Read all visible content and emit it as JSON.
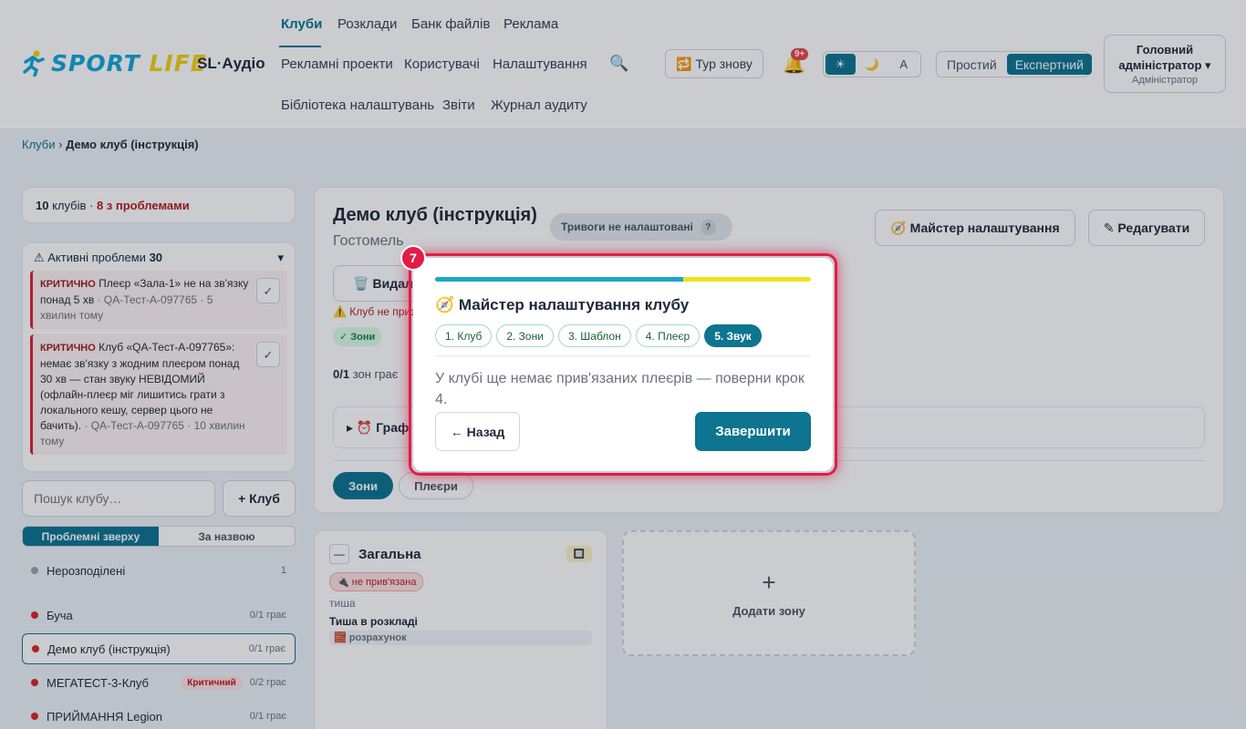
{
  "brand": {
    "logo_text_1": "SPORT ",
    "logo_text_2": "LIFE",
    "app_name": "SL·Аудіо",
    "accent": "#0e7490",
    "danger": "#dc2626"
  },
  "nav": {
    "row1": [
      "Клуби",
      "Розклади",
      "Банк файлів",
      "Реклама"
    ],
    "row2": [
      "Рекламні проекти",
      "Користувачі",
      "Налаштування"
    ],
    "row3": [
      "Бібліотека налаштувань",
      "Звіти",
      "Журнал аудиту"
    ],
    "active": "Клуби"
  },
  "header": {
    "search_icon": "🔍",
    "tour_label": "🔁 Тур знову",
    "bell_icon": "🔔",
    "bell_count": "9+",
    "theme_options": [
      "☀",
      "🌙",
      "A"
    ],
    "theme_active": "☀",
    "mode_simple": "Простий",
    "mode_expert": "Експертний",
    "user_name": "Головний адміністратор ▾",
    "user_role": "Адміністратор"
  },
  "breadcrumb": {
    "root": "Клуби",
    "separator": "›",
    "current": "Демо клуб (інструкція)"
  },
  "sidebar": {
    "summary_count": "10",
    "summary_clubs": " клубів · ",
    "summary_problems": "8 з проблемами",
    "issues_title": "⚠ Активні проблеми ",
    "issues_count": "30",
    "issues_toggle": "▾",
    "issues": [
      {
        "severity": "КРИТИЧНО",
        "text": " Плеєр «Зала-1» не на зв'язку понад 5 хв",
        "meta": " · QA-Тест-А-097765 · 5 хвилин тому",
        "ack": "✓"
      },
      {
        "severity": "КРИТИЧНО",
        "text": " Клуб «QA-Тест-А-097765»: немає зв'язку з жодним плеєром понад 30 хв — стан звуку НЕВІДОМИЙ (офлайн-плеєр міг лишитись грати з локального кешу, сервер цього не бачить).",
        "meta": " · QA-Тест-А-097765 · 10 хвилин тому",
        "ack": "✓"
      }
    ],
    "search_placeholder": "Пошук клубу…",
    "add_club": "+ Клуб",
    "sort_problems": "Проблемні зверху",
    "sort_name": "За назвою",
    "clubs": [
      {
        "name": "Нерозподілені",
        "count": "1",
        "dot": "#9ca3af",
        "tag": ""
      },
      {
        "name": "Буча",
        "count": "0/1 грає",
        "dot": "#dc2626",
        "tag": ""
      },
      {
        "name": "Демо клуб (інструкція)",
        "count": "0/1 грає",
        "dot": "#dc2626",
        "tag": ""
      },
      {
        "name": "МЕГАТЕСТ-3-Клуб",
        "count": "0/2 грає",
        "dot": "#dc2626",
        "tag": "Критичний"
      },
      {
        "name": "ПРИЙМАННЯ Legion",
        "count": "0/1 грає",
        "dot": "#dc2626",
        "tag": ""
      }
    ]
  },
  "main": {
    "title": "Демо клуб (інструкція)",
    "city": "Гостомель",
    "alarm_label": "Тривоги не налаштовані",
    "alarm_help": "?",
    "wizard_button": "🧭 Майстер налаштування",
    "edit_button": "✎ Редагувати",
    "delete_button": "🗑️ Видал",
    "warning": "⚠️ Клуб не приз",
    "chip_zones": "✓ Зони",
    "zones_playing_count": "0/1",
    "zones_playing_text": " зон грає",
    "schedule_title": "▸  ⏰ Граф",
    "tab_zones": "Зони",
    "tab_players": "Плеєри"
  },
  "zone": {
    "collapse": "—",
    "name": "Загальна",
    "square_icon": "🔲",
    "unbound": "🔌 не прив'язана",
    "status": "тиша",
    "schedule": "Тиша в розкладі",
    "calc": "🧱 розрахунок",
    "add_plus": "+",
    "add_label": "Додати зону"
  },
  "wizard": {
    "step_badge": "7",
    "progress": 0.66,
    "title": "🧭 Майстер налаштування клубу",
    "steps": [
      "1. Клуб",
      "2. Зони",
      "3. Шаблон",
      "4. Плеєр",
      "5. Звук"
    ],
    "active_step": 4,
    "message": "У клубі ще немає прив'язаних плеєрів — поверни крок 4.",
    "back": "← Назад",
    "finish": "Завершити"
  }
}
